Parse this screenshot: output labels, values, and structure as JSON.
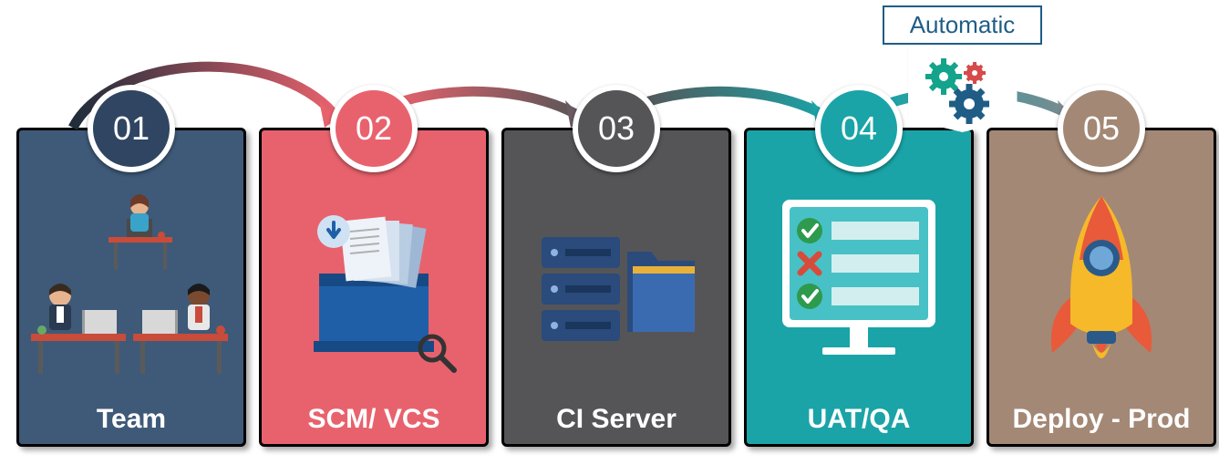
{
  "automatic_label": "Automatic",
  "stages": [
    {
      "num": "01",
      "label": "Team",
      "bg": "#3e5a78",
      "badge_bg": "#2f4561",
      "icon": "team"
    },
    {
      "num": "02",
      "label": "SCM/ VCS",
      "bg": "#e8626d",
      "badge_bg": "#e8626d",
      "icon": "vcs"
    },
    {
      "num": "03",
      "label": "CI Server",
      "bg": "#555557",
      "badge_bg": "#555557",
      "icon": "server"
    },
    {
      "num": "04",
      "label": "UAT/QA",
      "bg": "#1aa4a7",
      "badge_bg": "#1aa4a7",
      "icon": "qa"
    },
    {
      "num": "05",
      "label": "Deploy - Prod",
      "bg": "#a38876",
      "badge_bg": "#a38876",
      "icon": "rocket"
    }
  ],
  "arrows": [
    {
      "from": 0,
      "to": 1,
      "grad": [
        "#1f2d3a",
        "#e8626d"
      ]
    },
    {
      "from": 1,
      "to": 2,
      "grad": [
        "#e8626d",
        "#555557"
      ]
    },
    {
      "from": 2,
      "to": 3,
      "grad": [
        "#555557",
        "#1aa4a7"
      ]
    },
    {
      "from": 3,
      "to": 4,
      "grad": [
        "#1aa4a7",
        "#7d8a8f"
      ]
    }
  ]
}
